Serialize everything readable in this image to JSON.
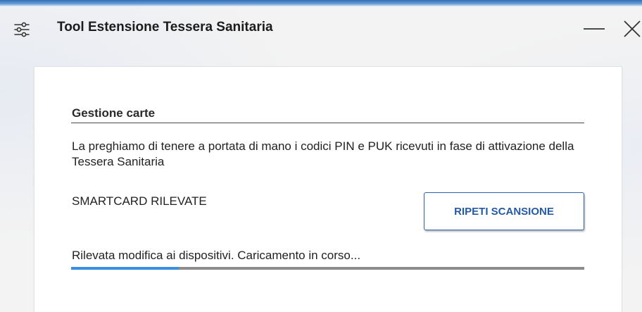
{
  "window": {
    "title": "Tool Estensione Tessera Sanitaria",
    "settings_icon": "settings-sliders-icon",
    "minimize_icon": "minimize-icon",
    "close_icon": "close-icon"
  },
  "card": {
    "section_title": "Gestione carte",
    "message": "La preghiamo di tenere a portata di mano i codici PIN e PUK ricevuti in fase di attivazione della Tessera Sanitaria",
    "detected_label": "SMARTCARD RILEVATE",
    "rescan_button_label": "RIPETI SCANSIONE",
    "status_text": "Rilevata modifica ai dispositivi. Caricamento in corso...",
    "progress_fraction": 0.21
  },
  "colors": {
    "accent": "#245aa5",
    "progress_fill": "#3a8fe0",
    "progress_track": "#8c8c8c",
    "card_background": "#ffffff",
    "window_background": "#f3f3f3"
  }
}
